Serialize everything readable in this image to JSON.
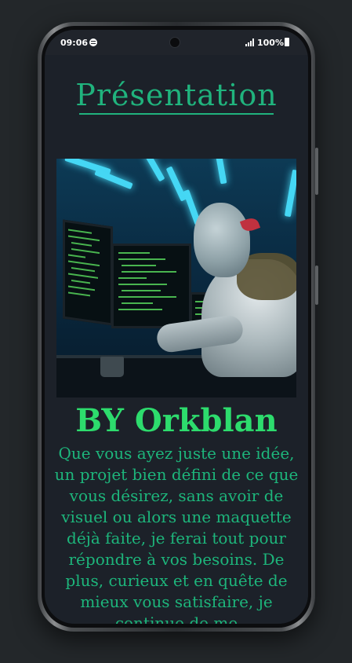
{
  "status_bar": {
    "time": "09:06",
    "battery": "100%",
    "icons": [
      "spotify-icon",
      "signal-icon",
      "battery-icon",
      "camera-cutout"
    ]
  },
  "page": {
    "title": "Présentation",
    "byline": "BY Orkblan",
    "description": "Que vous ayez juste une idée, un projet bien défini de ce que vous désirez, sans avoir de visuel ou alors une maquette déjà faite, je ferai tout pour répondre à vos besoins. De plus, curieux et en quête de mieux vous satisfaire, je continue de me"
  },
  "colors": {
    "background": "#23272a",
    "screen_bg": "#1c2129",
    "title_green": "#20b37d",
    "byline_green": "#2ddc6d",
    "text_green": "#1db57b"
  }
}
